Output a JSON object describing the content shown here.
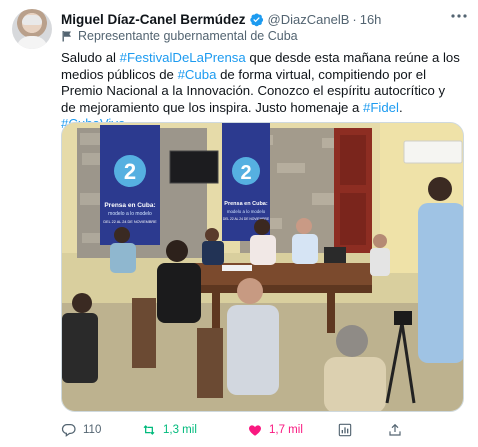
{
  "author": {
    "name": "Miguel Díaz-Canel Bermúdez",
    "handle": "@DiazCanelB",
    "separator": "·",
    "time": "16h",
    "affiliation_label": "Representante gubernamental de Cuba"
  },
  "tweet": {
    "segments": [
      {
        "text": "Saludo al ",
        "link": false
      },
      {
        "text": "#FestivalDeLaPrensa",
        "link": true
      },
      {
        "text": " que desde esta mañana reúne a los medios públicos de ",
        "link": false
      },
      {
        "text": "#Cuba",
        "link": true
      },
      {
        "text": " de forma virtual, compitiendo por el Premio Nacional a la Innovación. Conozco el espíritu autocrítico y de mejoramiento que los inspira. Justo homenaje a ",
        "link": false
      },
      {
        "text": "#Fidel",
        "link": true
      },
      {
        "text": ". ",
        "link": false
      },
      {
        "text": "#CubaVive",
        "link": true
      }
    ]
  },
  "media": {
    "banner_left": {
      "number": "2",
      "line1": "Prensa en Cuba:",
      "line2": "modelo a lo modelo",
      "line3": "DEL 22 AL 24 DE NOVIEMBRE"
    },
    "banner_right": {
      "number": "2",
      "line1": "Prensa en Cuba:",
      "line2": "modelo a lo modelo",
      "line3": "DEL 22 AL 24 DE NOVIEMBRE"
    }
  },
  "actions": {
    "reply_count": "110",
    "retweet_count": "1,3 mil",
    "like_count": "1,7 mil"
  },
  "colors": {
    "link": "#1d9bf0",
    "retweet": "#00ba7c",
    "like": "#f91880",
    "muted": "#536471",
    "verified": "#1d9bf0"
  },
  "icons": [
    "verified-badge-icon",
    "more-icon",
    "government-flag-icon",
    "reply-icon",
    "retweet-icon",
    "like-icon",
    "analytics-icon",
    "share-icon"
  ]
}
